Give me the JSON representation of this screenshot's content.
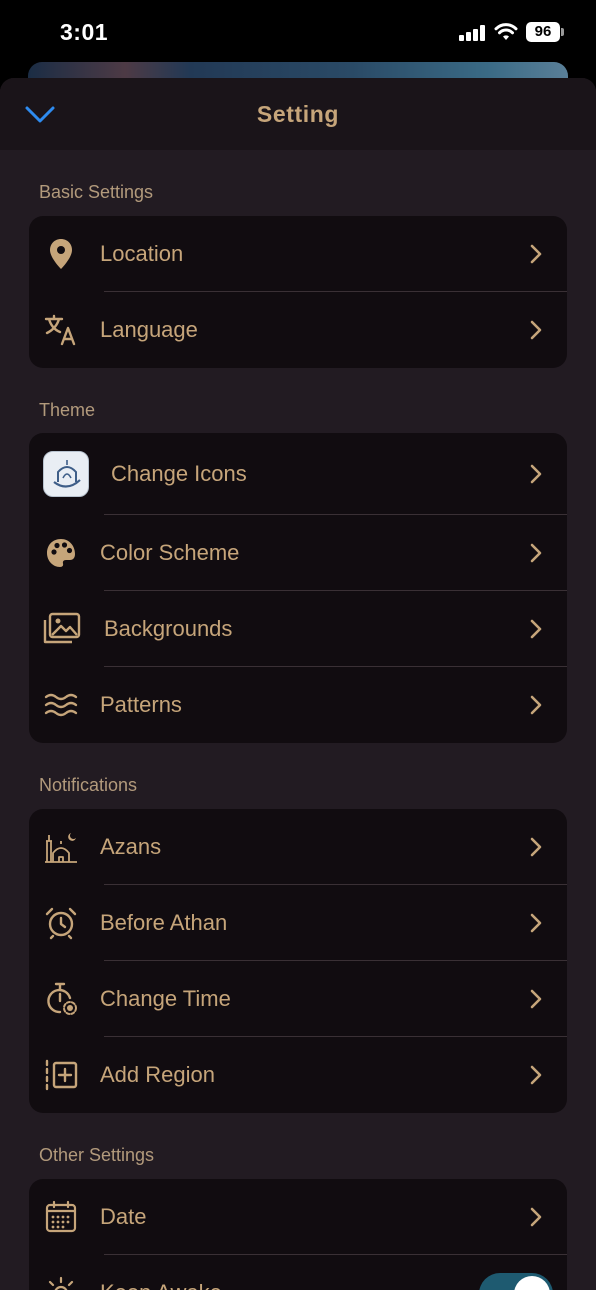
{
  "status": {
    "time": "3:01",
    "battery": "96"
  },
  "header": {
    "title": "Setting"
  },
  "sections": {
    "basic": {
      "title": "Basic Settings",
      "items": [
        {
          "label": "Location",
          "icon": "location-pin-icon"
        },
        {
          "label": "Language",
          "icon": "translate-icon"
        }
      ]
    },
    "theme": {
      "title": "Theme",
      "items": [
        {
          "label": "Change Icons",
          "icon": "app-icon"
        },
        {
          "label": "Color Scheme",
          "icon": "palette-icon"
        },
        {
          "label": "Backgrounds",
          "icon": "images-icon"
        },
        {
          "label": "Patterns",
          "icon": "waves-icon"
        }
      ]
    },
    "notifications": {
      "title": "Notifications",
      "items": [
        {
          "label": "Azans",
          "icon": "mosque-icon"
        },
        {
          "label": "Before Athan",
          "icon": "alarm-clock-icon"
        },
        {
          "label": "Change Time",
          "icon": "timer-settings-icon"
        },
        {
          "label": "Add Region",
          "icon": "add-region-icon"
        }
      ]
    },
    "other": {
      "title": "Other Settings",
      "items": [
        {
          "label": "Date",
          "icon": "calendar-icon"
        },
        {
          "label": "Keep Awake",
          "icon": "sun-icon",
          "toggle": true
        }
      ]
    }
  },
  "colors": {
    "accent": "#c6a57a",
    "chevron": "#2e8bef",
    "toggle_on": "#1e5a70"
  }
}
